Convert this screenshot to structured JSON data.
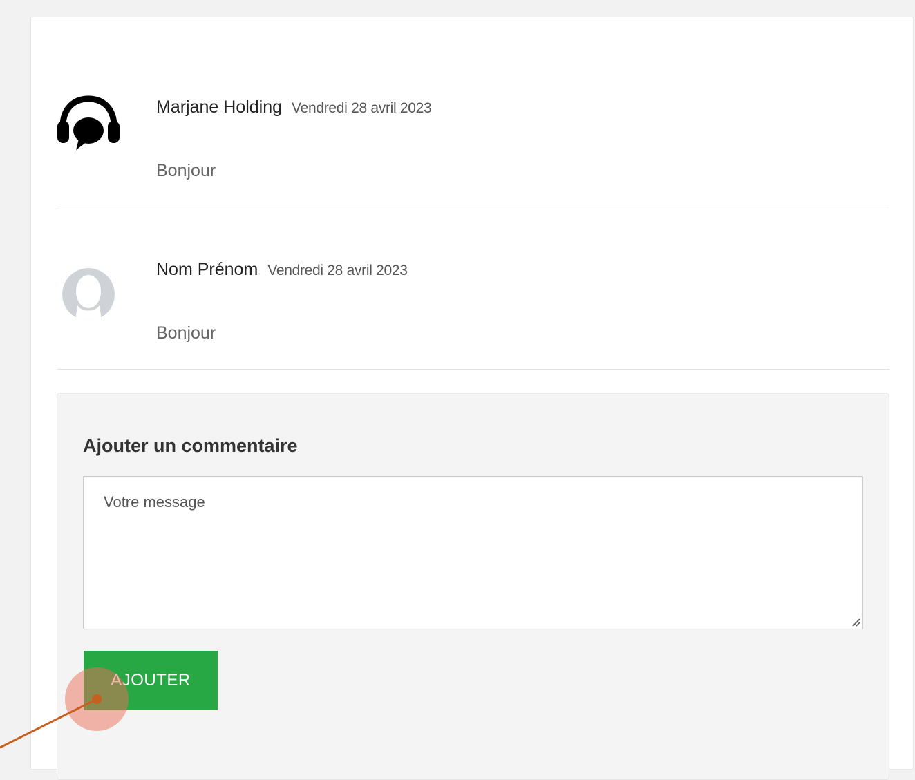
{
  "comments": [
    {
      "author": "Marjane Holding",
      "date": "Vendredi 28 avril 2023",
      "body": "Bonjour",
      "avatar_icon": "headset-chat-icon"
    },
    {
      "author": "Nom Prénom",
      "date": "Vendredi 28 avril 2023",
      "body": "Bonjour",
      "avatar_icon": "default-user-icon"
    }
  ],
  "form": {
    "title": "Ajouter un commentaire",
    "message_placeholder": "Votre message",
    "message_value": "",
    "submit_label": "AJOUTER"
  },
  "colors": {
    "button": "#28a745",
    "page_background": "#f2f2f2",
    "form_background": "#f4f4f4",
    "default_avatar": "#cfd3d7",
    "click_marker": "#ec6e5a",
    "click_pointer": "#c75f1e"
  }
}
